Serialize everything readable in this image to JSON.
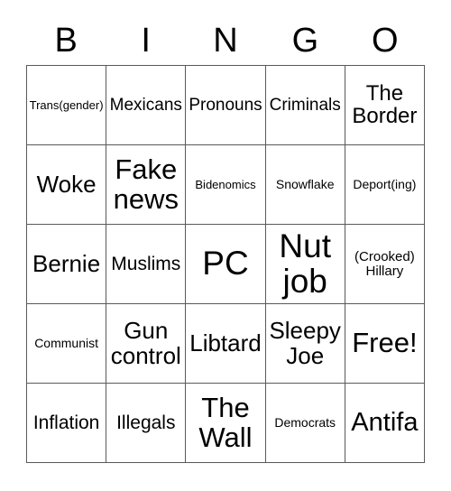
{
  "card": {
    "title": "BINGO",
    "header_letters": [
      "B",
      "I",
      "N",
      "G",
      "O"
    ],
    "colors": {
      "background": "#ffffff",
      "text": "#000000",
      "grid_border": "#5a5a5a"
    },
    "rows": [
      [
        {
          "text": "Trans(gender)",
          "size": "sz-xs"
        },
        {
          "text": "Mexicans",
          "size": "sz-m"
        },
        {
          "text": "Pronouns",
          "size": "sz-m"
        },
        {
          "text": "Criminals",
          "size": "sz-m"
        },
        {
          "text": "The\nBorder",
          "size": "sz-l"
        }
      ],
      [
        {
          "text": "Woke",
          "size": "sz-xl"
        },
        {
          "text": "Fake\nnews",
          "size": "sz-3xl"
        },
        {
          "text": "Bidenomics",
          "size": "sz-xs"
        },
        {
          "text": "Snowflake",
          "size": "sz-s"
        },
        {
          "text": "Deport(ing)",
          "size": "sz-s"
        }
      ],
      [
        {
          "text": "Bernie",
          "size": "sz-xl"
        },
        {
          "text": "Muslims",
          "size": "sz-ml"
        },
        {
          "text": "PC",
          "size": "sz-4xl"
        },
        {
          "text": "Nut\njob",
          "size": "sz-4xl"
        },
        {
          "text": "(Crooked)\nHillary",
          "size": "sz-sm"
        }
      ],
      [
        {
          "text": "Communist",
          "size": "sz-s"
        },
        {
          "text": "Gun\ncontrol",
          "size": "sz-xl"
        },
        {
          "text": "Libtard",
          "size": "sz-xl"
        },
        {
          "text": "Sleepy\nJoe",
          "size": "sz-xl"
        },
        {
          "text": "Free!",
          "size": "sz-3xl"
        }
      ],
      [
        {
          "text": "Inflation",
          "size": "sz-ml"
        },
        {
          "text": "Illegals",
          "size": "sz-ml"
        },
        {
          "text": "The\nWall",
          "size": "sz-3xl"
        },
        {
          "text": "Democrats",
          "size": "sz-s"
        },
        {
          "text": "Antifa",
          "size": "sz-xxl"
        }
      ]
    ]
  }
}
